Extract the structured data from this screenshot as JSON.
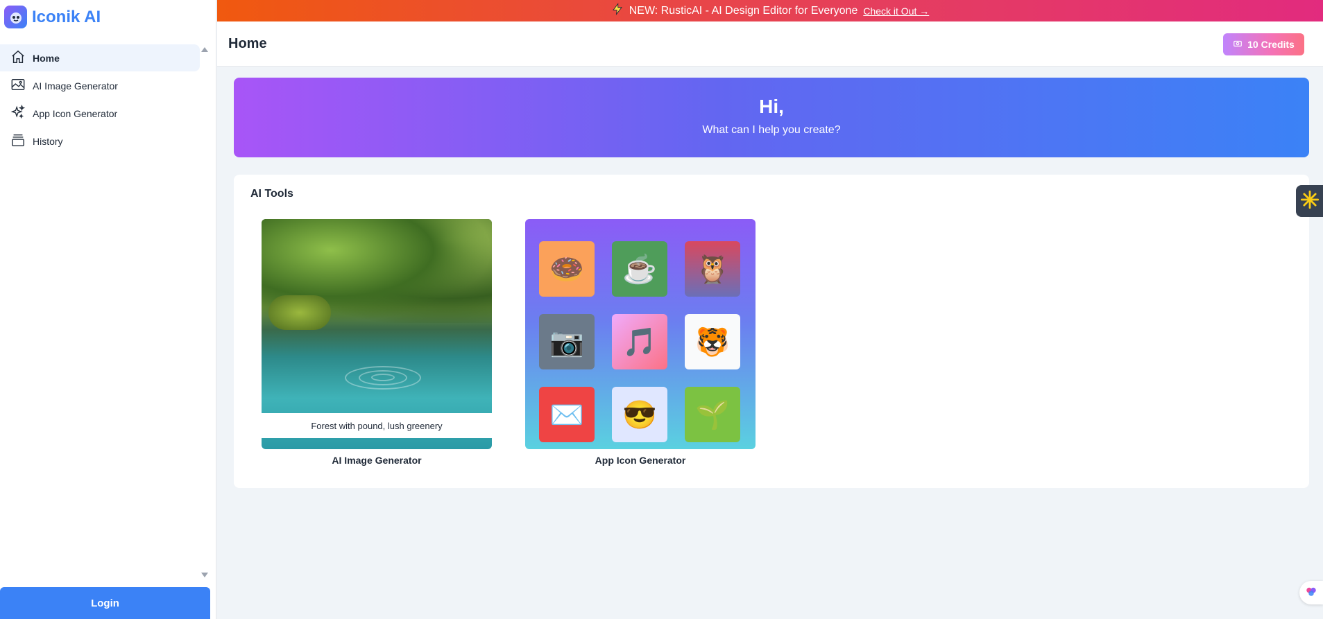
{
  "app": {
    "name": "Iconik AI"
  },
  "banner": {
    "text": "NEW: RusticAI - AI Design Editor for Everyone",
    "link": "Check it Out →"
  },
  "sidebar": {
    "items": [
      {
        "label": "Home",
        "icon": "home-icon",
        "active": true
      },
      {
        "label": "AI Image Generator",
        "icon": "image-icon",
        "active": false
      },
      {
        "label": "App Icon Generator",
        "icon": "sparkle-icon",
        "active": false
      },
      {
        "label": "History",
        "icon": "archive-icon",
        "active": false
      }
    ],
    "login_label": "Login"
  },
  "header": {
    "title": "Home",
    "credits": "10 Credits"
  },
  "hero": {
    "title": "Hi,",
    "subtitle": "What can I help you create?"
  },
  "tools": {
    "title": "AI Tools",
    "cards": [
      {
        "label": "AI Image Generator",
        "caption": "Forest with pound, lush greenery"
      },
      {
        "label": "App Icon Generator"
      }
    ]
  },
  "colors": {
    "accent": "#3b82f6",
    "banner_start": "#f0590f",
    "banner_end": "#e22b7e"
  }
}
